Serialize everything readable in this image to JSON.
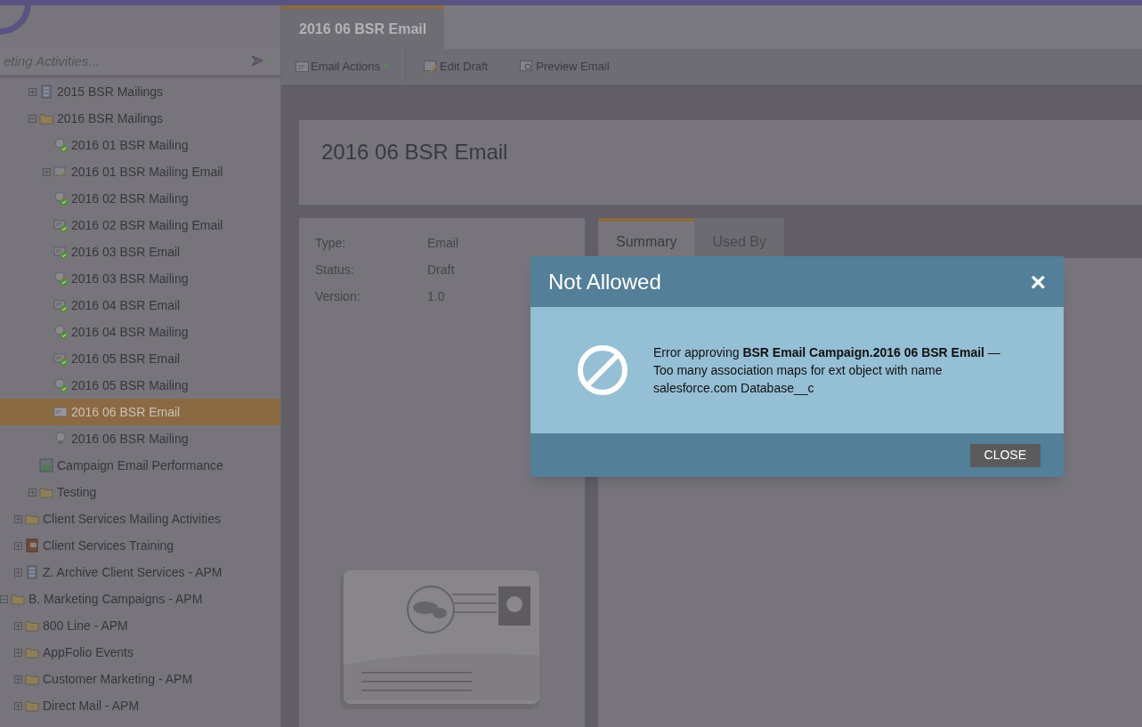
{
  "sidebar": {
    "search": {
      "placeholder": "eting Activities..."
    },
    "tree": [
      {
        "children": [
          {
            "children": [
              {
                "label": "2015 BSR Mailings",
                "kind": "archive",
                "expanded": false,
                "selected": false
              },
              {
                "label": "2016 BSR Mailings",
                "kind": "folder",
                "expanded": true,
                "selected": false,
                "children": [
                  {
                    "label": "2016 01 BSR Mailing",
                    "kind": "program_approved",
                    "selected": false
                  },
                  {
                    "label": "2016 01 BSR Mailing Email",
                    "kind": "email_edit",
                    "expanded": false,
                    "selected": false
                  },
                  {
                    "label": "2016 02 BSR Mailing",
                    "kind": "program_approved",
                    "selected": false
                  },
                  {
                    "label": "2016 02 BSR Mailing Email",
                    "kind": "email_approved",
                    "selected": false
                  },
                  {
                    "label": "2016 03 BSR Email",
                    "kind": "email_approved",
                    "selected": false
                  },
                  {
                    "label": "2016 03 BSR Mailing",
                    "kind": "program_approved",
                    "selected": false
                  },
                  {
                    "label": "2016 04 BSR Email",
                    "kind": "email_approved",
                    "selected": false
                  },
                  {
                    "label": "2016 04 BSR Mailing",
                    "kind": "program_approved",
                    "selected": false
                  },
                  {
                    "label": "2016 05 BSR Email",
                    "kind": "email_approved",
                    "selected": false
                  },
                  {
                    "label": "2016 05 BSR Mailing",
                    "kind": "program_approved",
                    "selected": false
                  },
                  {
                    "label": "2016 06 BSR Email",
                    "kind": "email",
                    "selected": true
                  },
                  {
                    "label": "2016 06 BSR Mailing",
                    "kind": "program",
                    "selected": false
                  }
                ]
              },
              {
                "label": "Campaign Email Performance",
                "kind": "report",
                "selected": false
              },
              {
                "label": "Testing",
                "kind": "folder",
                "expanded": false,
                "selected": false
              }
            ]
          },
          {
            "label": "Client Services Mailing Activities",
            "kind": "folder",
            "expanded": false,
            "selected": false
          },
          {
            "label": "Client Services Training",
            "kind": "book",
            "expanded": false,
            "selected": false
          },
          {
            "label": "Z. Archive Client Services - APM",
            "kind": "archive",
            "expanded": false,
            "selected": false
          }
        ]
      },
      {
        "label": "B. Marketing Campaigns - APM",
        "kind": "folder",
        "expanded": true,
        "selected": false,
        "children": [
          {
            "label": "800 Line - APM",
            "kind": "folder",
            "expanded": false,
            "selected": false
          },
          {
            "label": "AppFolio Events",
            "kind": "folder",
            "expanded": false,
            "selected": false
          },
          {
            "label": "Customer Marketing - APM",
            "kind": "folder",
            "expanded": false,
            "selected": false
          },
          {
            "label": "Direct Mail - APM",
            "kind": "folder",
            "expanded": false,
            "selected": false
          }
        ]
      }
    ]
  },
  "tabs": [
    {
      "label": "2016 06 BSR Email",
      "selected": true
    }
  ],
  "toolbar": [
    {
      "label": "Email Actions",
      "kind": "menu"
    },
    {
      "label": "Edit Draft",
      "kind": "edit"
    },
    {
      "label": "Preview Email",
      "kind": "preview"
    }
  ],
  "header": {
    "title": "2016 06 BSR Email"
  },
  "details": [
    {
      "label": "Type:",
      "value": "Email"
    },
    {
      "label": "Status:",
      "value": "Draft"
    },
    {
      "label": "Version:",
      "value": "1.0"
    }
  ],
  "panel_tabs": [
    {
      "label": "Summary",
      "selected": true
    },
    {
      "label": "Used By",
      "selected": false
    }
  ],
  "dialog": {
    "title": "Not Allowed",
    "close_glyph": "×",
    "message": "Error approving **BSR Email Campaign.2016 06 BSR Email** — Too many association maps for ext object with name salesforce.com Database__c",
    "button": "CLOSE"
  }
}
